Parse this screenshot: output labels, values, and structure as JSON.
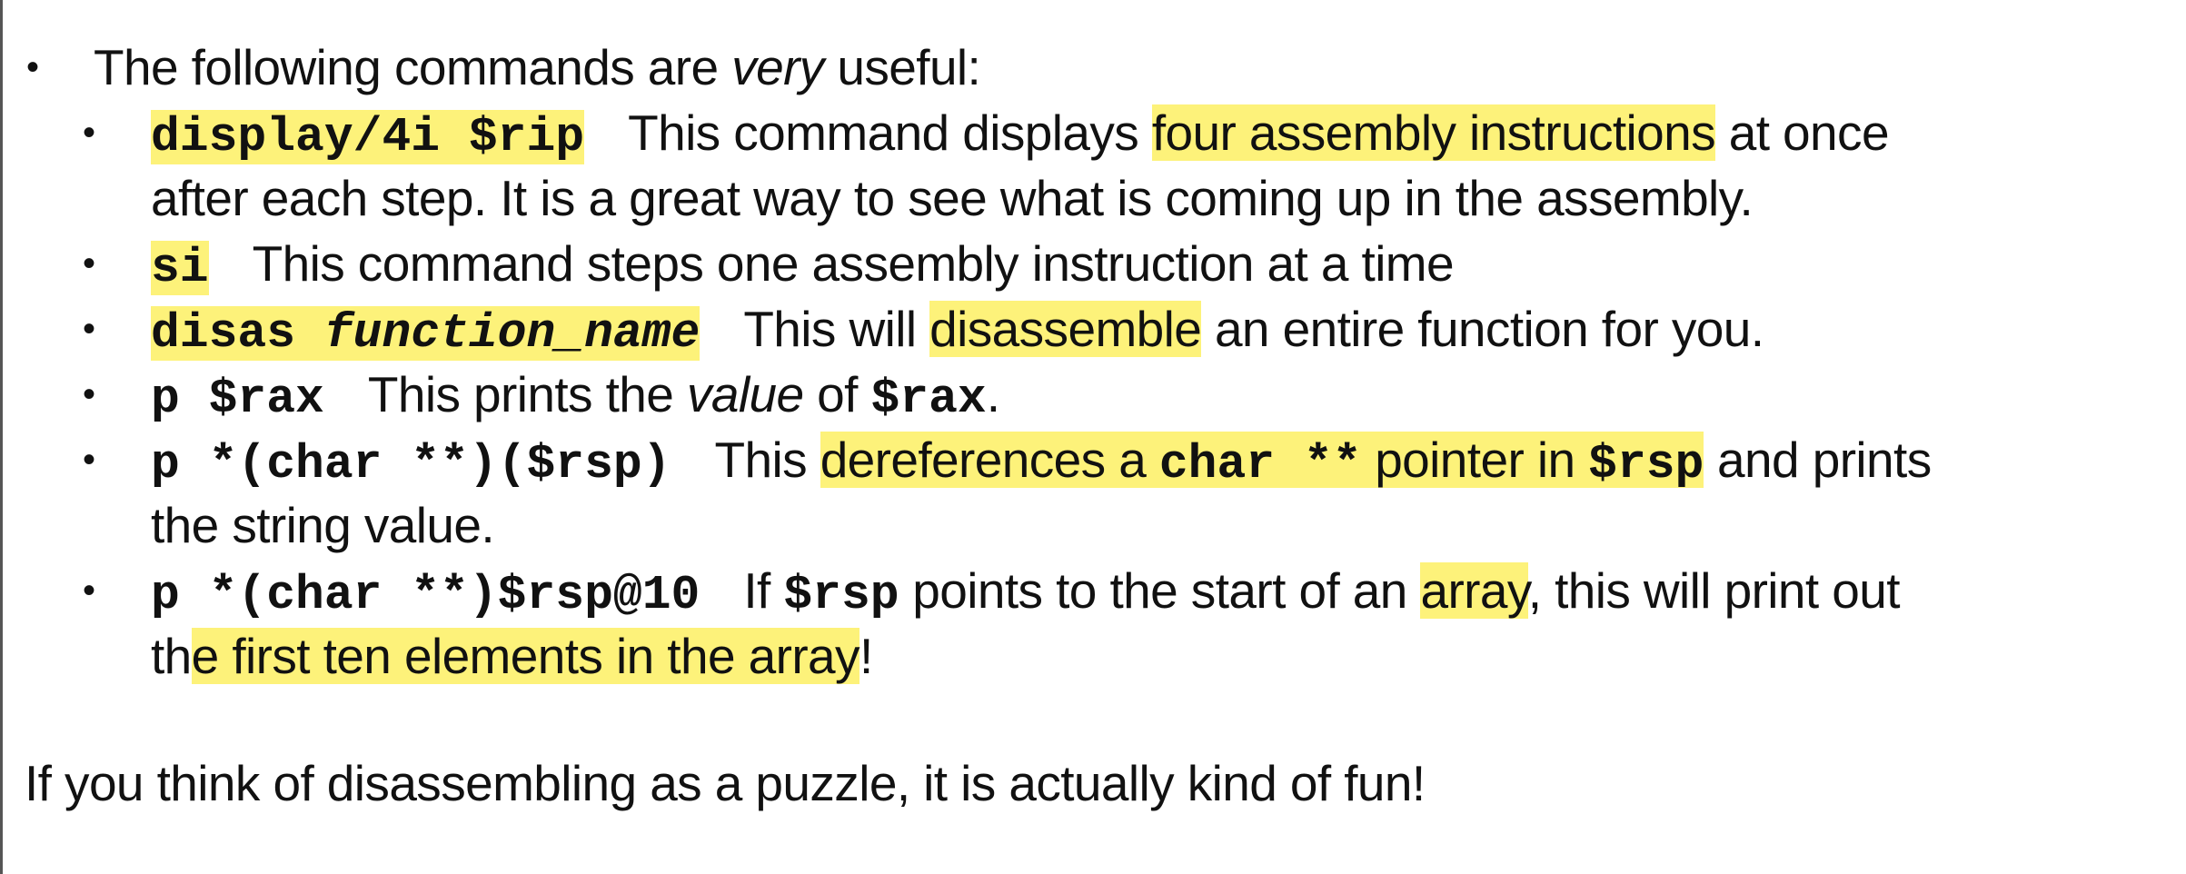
{
  "intro": {
    "bullet": "•",
    "before": "The following commands are ",
    "emph": "very",
    "after": " useful:"
  },
  "items": [
    {
      "bullet": "•",
      "command": "display/4i $rip",
      "text_before": "This command displays ",
      "highlight": "four assembly instructions",
      "text_after": " at once",
      "continuation": "after each step. It is a great way to see what is coming up in the assembly."
    },
    {
      "bullet": "•",
      "command": "si",
      "text": "This command steps one assembly instruction at a time"
    },
    {
      "bullet": "•",
      "command_prefix": "disas ",
      "command_arg": "function_name",
      "text_before": "This will ",
      "highlight": "disassemble",
      "text_after": " an entire function for you."
    },
    {
      "bullet": "•",
      "command": "p $rax",
      "text_before": "This prints the ",
      "emph": "value",
      "text_mid": " of ",
      "code_ref": "$rax",
      "text_after": "."
    },
    {
      "bullet": "•",
      "command": "p *(char **)($rsp)",
      "text_before": "This ",
      "hl_text1": "dereferences a ",
      "hl_code1": "char **",
      "hl_text2": " pointer in ",
      "hl_code2": "$rsp",
      "text_after": " and prints",
      "continuation": "the string value."
    },
    {
      "bullet": "•",
      "command": "p *(char **)$rsp@10",
      "text_before": "If ",
      "code_ref": "$rsp",
      "text_mid": " points to the start of an ",
      "highlight": "array",
      "text_after": ", this will print out",
      "cont_before": "th",
      "cont_highlight": "e first ten elements in the array",
      "cont_after": "!"
    }
  ],
  "closing": "If you think of disassembling as a puzzle, it is actually kind of fun!",
  "colors": {
    "highlight": "#fdf27a",
    "text": "#111111",
    "border": "#555555"
  }
}
